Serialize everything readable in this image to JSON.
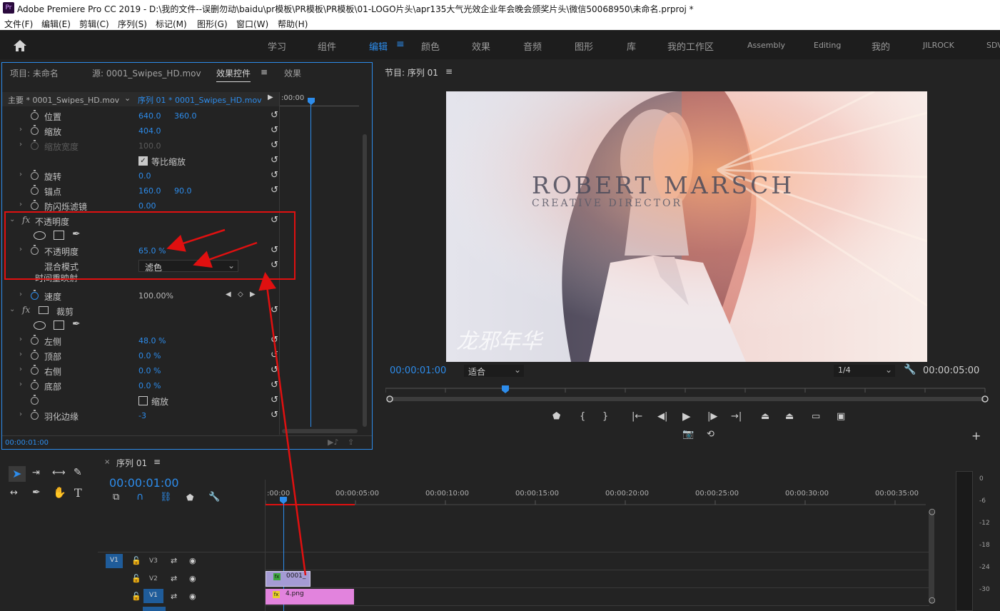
{
  "titlebar": {
    "icon": "Pr",
    "title": "Adobe Premiere Pro CC 2019 - D:\\我的文件--误删勿动\\baidu\\pr模板\\PR模板\\PR模板\\01-LOGO片头\\apr135大气光效企业年会晚会颁奖片头\\微信50068950\\未命名.prproj *"
  },
  "menu": [
    "文件(F)",
    "编辑(E)",
    "剪辑(C)",
    "序列(S)",
    "标记(M)",
    "图形(G)",
    "窗口(W)",
    "帮助(H)"
  ],
  "workspaces": [
    "学习",
    "组件",
    "编辑",
    "颜色",
    "效果",
    "音频",
    "图形",
    "库",
    "我的工作区",
    "Assembly",
    "Editing",
    "我的",
    "JILROCK",
    "SDV"
  ],
  "effect_controls": {
    "tabs": [
      "项目: 未命名",
      "源: 0001_Swipes_HD.mov",
      "效果控件",
      "效果"
    ],
    "master_clip": "主要 * 0001_Swipes_HD.mov",
    "sequence_clip": "序列 01 * 0001_Swipes_HD.mov",
    "ruler_time": ":00:00",
    "current_time": "00:00:01:00",
    "rows": {
      "position": {
        "label": "位置",
        "v1": "640.0",
        "v2": "360.0"
      },
      "scale": {
        "label": "缩放",
        "v1": "404.0"
      },
      "scale_width": {
        "label": "缩放宽度",
        "v1": "100.0"
      },
      "uniform_scale": {
        "label": "等比缩放"
      },
      "rotation": {
        "label": "旋转",
        "v1": "0.0"
      },
      "anchor": {
        "label": "锚点",
        "v1": "160.0",
        "v2": "90.0"
      },
      "antiflicker": {
        "label": "防闪烁滤镜",
        "v1": "0.00"
      },
      "opacity_group": {
        "fx": "fx",
        "label": "不透明度"
      },
      "opacity": {
        "label": "不透明度",
        "v1": "65.0 %"
      },
      "blend_mode": {
        "label": "混合模式",
        "value": "滤色"
      },
      "time_remap": {
        "label": "时间重映射"
      },
      "speed": {
        "label": "速度",
        "v1": "100.00%"
      },
      "crop_group": {
        "fx": "fx",
        "label": "裁剪"
      },
      "left": {
        "label": "左侧",
        "v1": "48.0 %"
      },
      "top": {
        "label": "顶部",
        "v1": "0.0 %"
      },
      "right": {
        "label": "右侧",
        "v1": "0.0 %"
      },
      "bottom": {
        "label": "底部",
        "v1": "0.0 %"
      },
      "zoom": {
        "label": "缩放"
      },
      "feather": {
        "label": "羽化边缘",
        "v1": "-3"
      }
    }
  },
  "program_monitor": {
    "title": "节目: 序列 01",
    "timecode": "00:00:01:00",
    "fit": "适合",
    "resolution": "1/4",
    "duration": "00:00:05:00",
    "overlay": {
      "name": "ROBERT MARSCH",
      "role": "CREATIVE DIRECTOR",
      "watermark": "龙邪年华"
    }
  },
  "timeline": {
    "tab": "序列 01",
    "timecode": "00:00:01:00",
    "ruler": [
      ":00:00",
      "00:00:05:00",
      "00:00:10:00",
      "00:00:15:00",
      "00:00:20:00",
      "00:00:25:00",
      "00:00:30:00",
      "00:00:35:00"
    ],
    "tracks": [
      "V3",
      "V2",
      "V1"
    ],
    "source_patch": "V1",
    "clips": [
      {
        "track": "V2",
        "name": "0001_",
        "badge": "fx",
        "color": "#a59bd4"
      },
      {
        "track": "V1",
        "name": "4.png",
        "badge": "fx",
        "color": "#e283dd"
      }
    ]
  },
  "meters": {
    "labels": [
      "0",
      "-6",
      "-12",
      "-18",
      "-24",
      "-30"
    ]
  },
  "colors": {
    "accent": "#2d8ceb",
    "annotation": "#e01010",
    "playhead": "#2d8ceb"
  }
}
